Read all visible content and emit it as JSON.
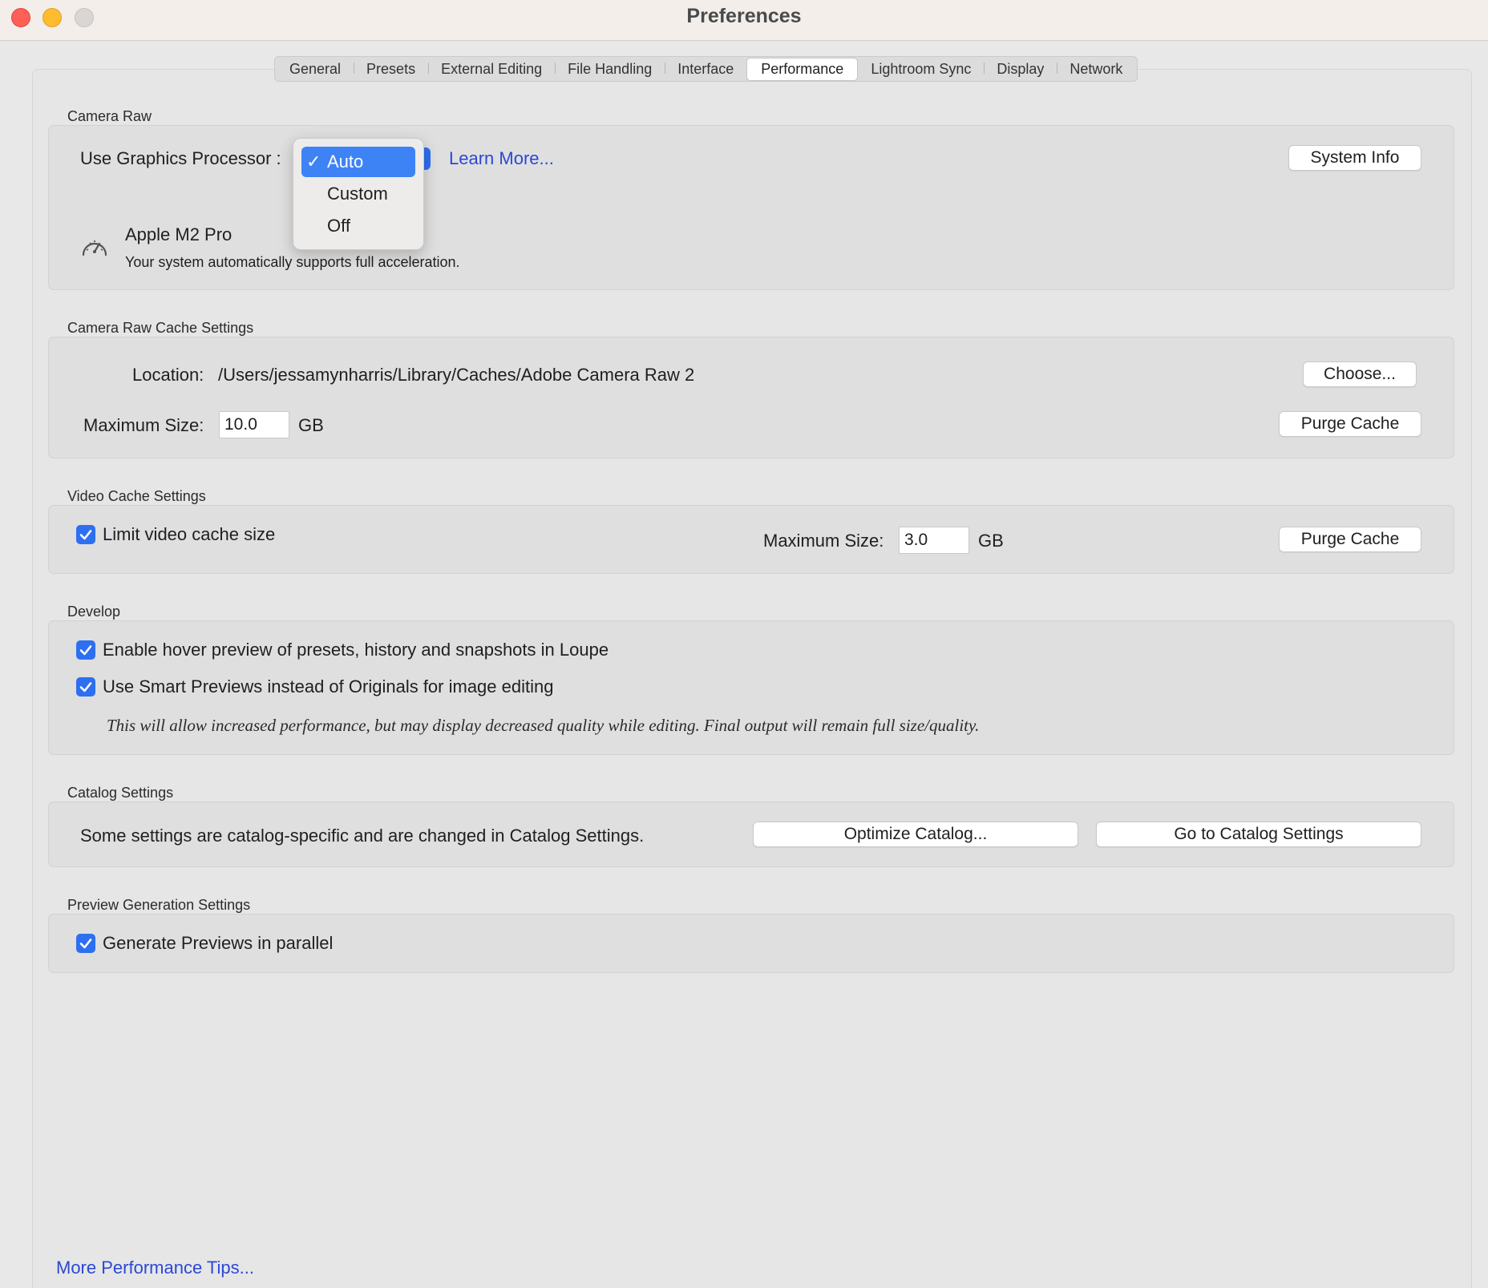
{
  "window": {
    "title": "Preferences"
  },
  "tabs": [
    "General",
    "Presets",
    "External Editing",
    "File Handling",
    "Interface",
    "Performance",
    "Lightroom Sync",
    "Display",
    "Network"
  ],
  "active_tab": "Performance",
  "camera_raw": {
    "section_label": "Camera Raw",
    "gpu_label": "Use Graphics Processor :",
    "gpu_options": [
      "Auto",
      "Custom",
      "Off"
    ],
    "gpu_selected": "Auto",
    "learn_more": "Learn More...",
    "system_info_button": "System Info",
    "gpu_name": "Apple M2 Pro",
    "gpu_status": "Your system automatically supports full acceleration."
  },
  "cache": {
    "section_label": "Camera Raw Cache Settings",
    "location_label": "Location:",
    "location_path": "/Users/jessamynharris/Library/Caches/Adobe Camera Raw 2",
    "choose_button": "Choose...",
    "max_size_label": "Maximum Size:",
    "max_size_value": "10.0",
    "unit": "GB",
    "purge_button": "Purge Cache"
  },
  "video_cache": {
    "section_label": "Video Cache Settings",
    "limit_label": "Limit video cache size",
    "limit_checked": true,
    "max_size_label": "Maximum Size:",
    "max_size_value": "3.0",
    "unit": "GB",
    "purge_button": "Purge Cache"
  },
  "develop": {
    "section_label": "Develop",
    "hover_preview_label": "Enable hover preview of presets, history and snapshots in Loupe",
    "hover_preview_checked": true,
    "smart_previews_label": "Use Smart Previews instead of Originals for image editing",
    "smart_previews_checked": true,
    "note": "This will allow increased performance, but may display decreased quality while editing. Final output will remain full size/quality."
  },
  "catalog": {
    "section_label": "Catalog Settings",
    "text": "Some settings are catalog-specific and are changed in Catalog Settings.",
    "optimize_button": "Optimize Catalog...",
    "goto_button": "Go to Catalog Settings"
  },
  "preview_generation": {
    "section_label": "Preview Generation Settings",
    "parallel_label": "Generate Previews in parallel",
    "parallel_checked": true
  },
  "footer": {
    "tips_link": "More Performance Tips..."
  },
  "colors": {
    "accent": "#2d6ff0",
    "link": "#2b48d6",
    "close": "#fe5f57",
    "minimize": "#febc2e"
  }
}
